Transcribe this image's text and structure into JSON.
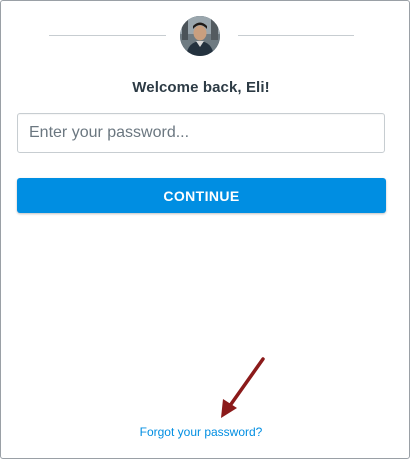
{
  "login": {
    "welcome_text": "Welcome back, Eli!",
    "password_placeholder": "Enter your password...",
    "continue_label": "CONTINUE",
    "forgot_link": "Forgot your password?"
  },
  "icons": {
    "avatar": "user-avatar-photo",
    "annotation": "red-arrow-icon"
  },
  "colors": {
    "accent": "#008ee2",
    "text": "#2d3b45",
    "annotation": "#8b1a1a"
  }
}
